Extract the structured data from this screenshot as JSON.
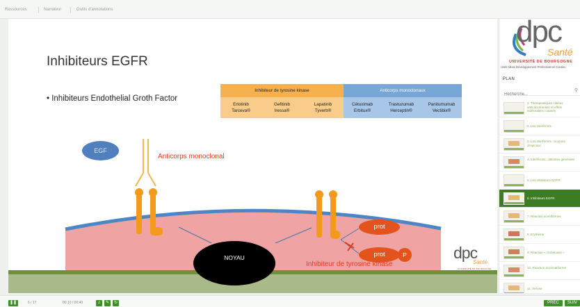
{
  "topbar": {
    "tabs": [
      "Ressources",
      "Narrateur",
      "Outils d'annotations"
    ]
  },
  "slide": {
    "title": "Inhibiteurs EGFR",
    "bullet": "• Inhibiteurs Endothelial Groth Factor",
    "table": {
      "headers": [
        "Inhibiteur de tyrosine kinase",
        "Anticorps monoclonaux"
      ],
      "cells": [
        {
          "l1": "Erlotinib",
          "l2": "Tarceva®"
        },
        {
          "l1": "Gefitinib",
          "l2": "Iressa®"
        },
        {
          "l1": "Lapatinib",
          "l2": "Tyverb®"
        },
        {
          "l1": "Cétuximab",
          "l2": "Erbitux®"
        },
        {
          "l1": "Trastuzumab",
          "l2": "Herceptin®"
        },
        {
          "l1": "Panitumumab",
          "l2": "Vectibix®"
        }
      ]
    },
    "diagram": {
      "egf": "EGF",
      "anticorps_label": "Anticorps monoclonal",
      "prot1": "prot",
      "prot2": "prot",
      "p": "P",
      "noyau": "NOYAU",
      "itk_label": "Inhibiteur de tyrosine kinase"
    },
    "mini_logo": {
      "dpc": "dpc",
      "sante": "Santé",
      "ub": "UNIVERSITÉ DE BOURGOGNE"
    }
  },
  "sidebar": {
    "logo": {
      "dpc": "dpc",
      "sante": "Santé",
      "university": "UNIVERSITÉ DE BOURGOGNE",
      "subtitle": "Unité Mixte Développement Professionnel Continu"
    },
    "plan_label": "PLAN",
    "search_placeholder": "Recherche...",
    "items": [
      {
        "label": "1. Thérapeutiques ciblées anticancéreuses et effets indésirables cutanés"
      },
      {
        "label": "2. Les interférons"
      },
      {
        "label": "3. Les interférons : Au point d'injection"
      },
      {
        "label": "4. Interférons : atteintes générales"
      },
      {
        "label": "5. Les inhibiteurs EGFR"
      },
      {
        "label": "6. Inhibiteurs EGFR"
      },
      {
        "label": "7. Réaction acnéiformes"
      },
      {
        "label": "8. Erythème"
      },
      {
        "label": "9. Réaction « croûteuses »"
      },
      {
        "label": "10. Réaction eczématiforme"
      },
      {
        "label": "11. Xérose"
      }
    ],
    "active_index": 5
  },
  "bottom": {
    "slide_counter": "6 / 17",
    "time": "00:10 / 00:40",
    "prev_label": "PRÉC",
    "next_label": "SUIV"
  },
  "colors": {
    "accent_green": "#3c7c22",
    "orange": "#f6b04d",
    "blue": "#78a6d6",
    "red_text": "#e23b1e",
    "prot_orange": "#e2541c"
  }
}
